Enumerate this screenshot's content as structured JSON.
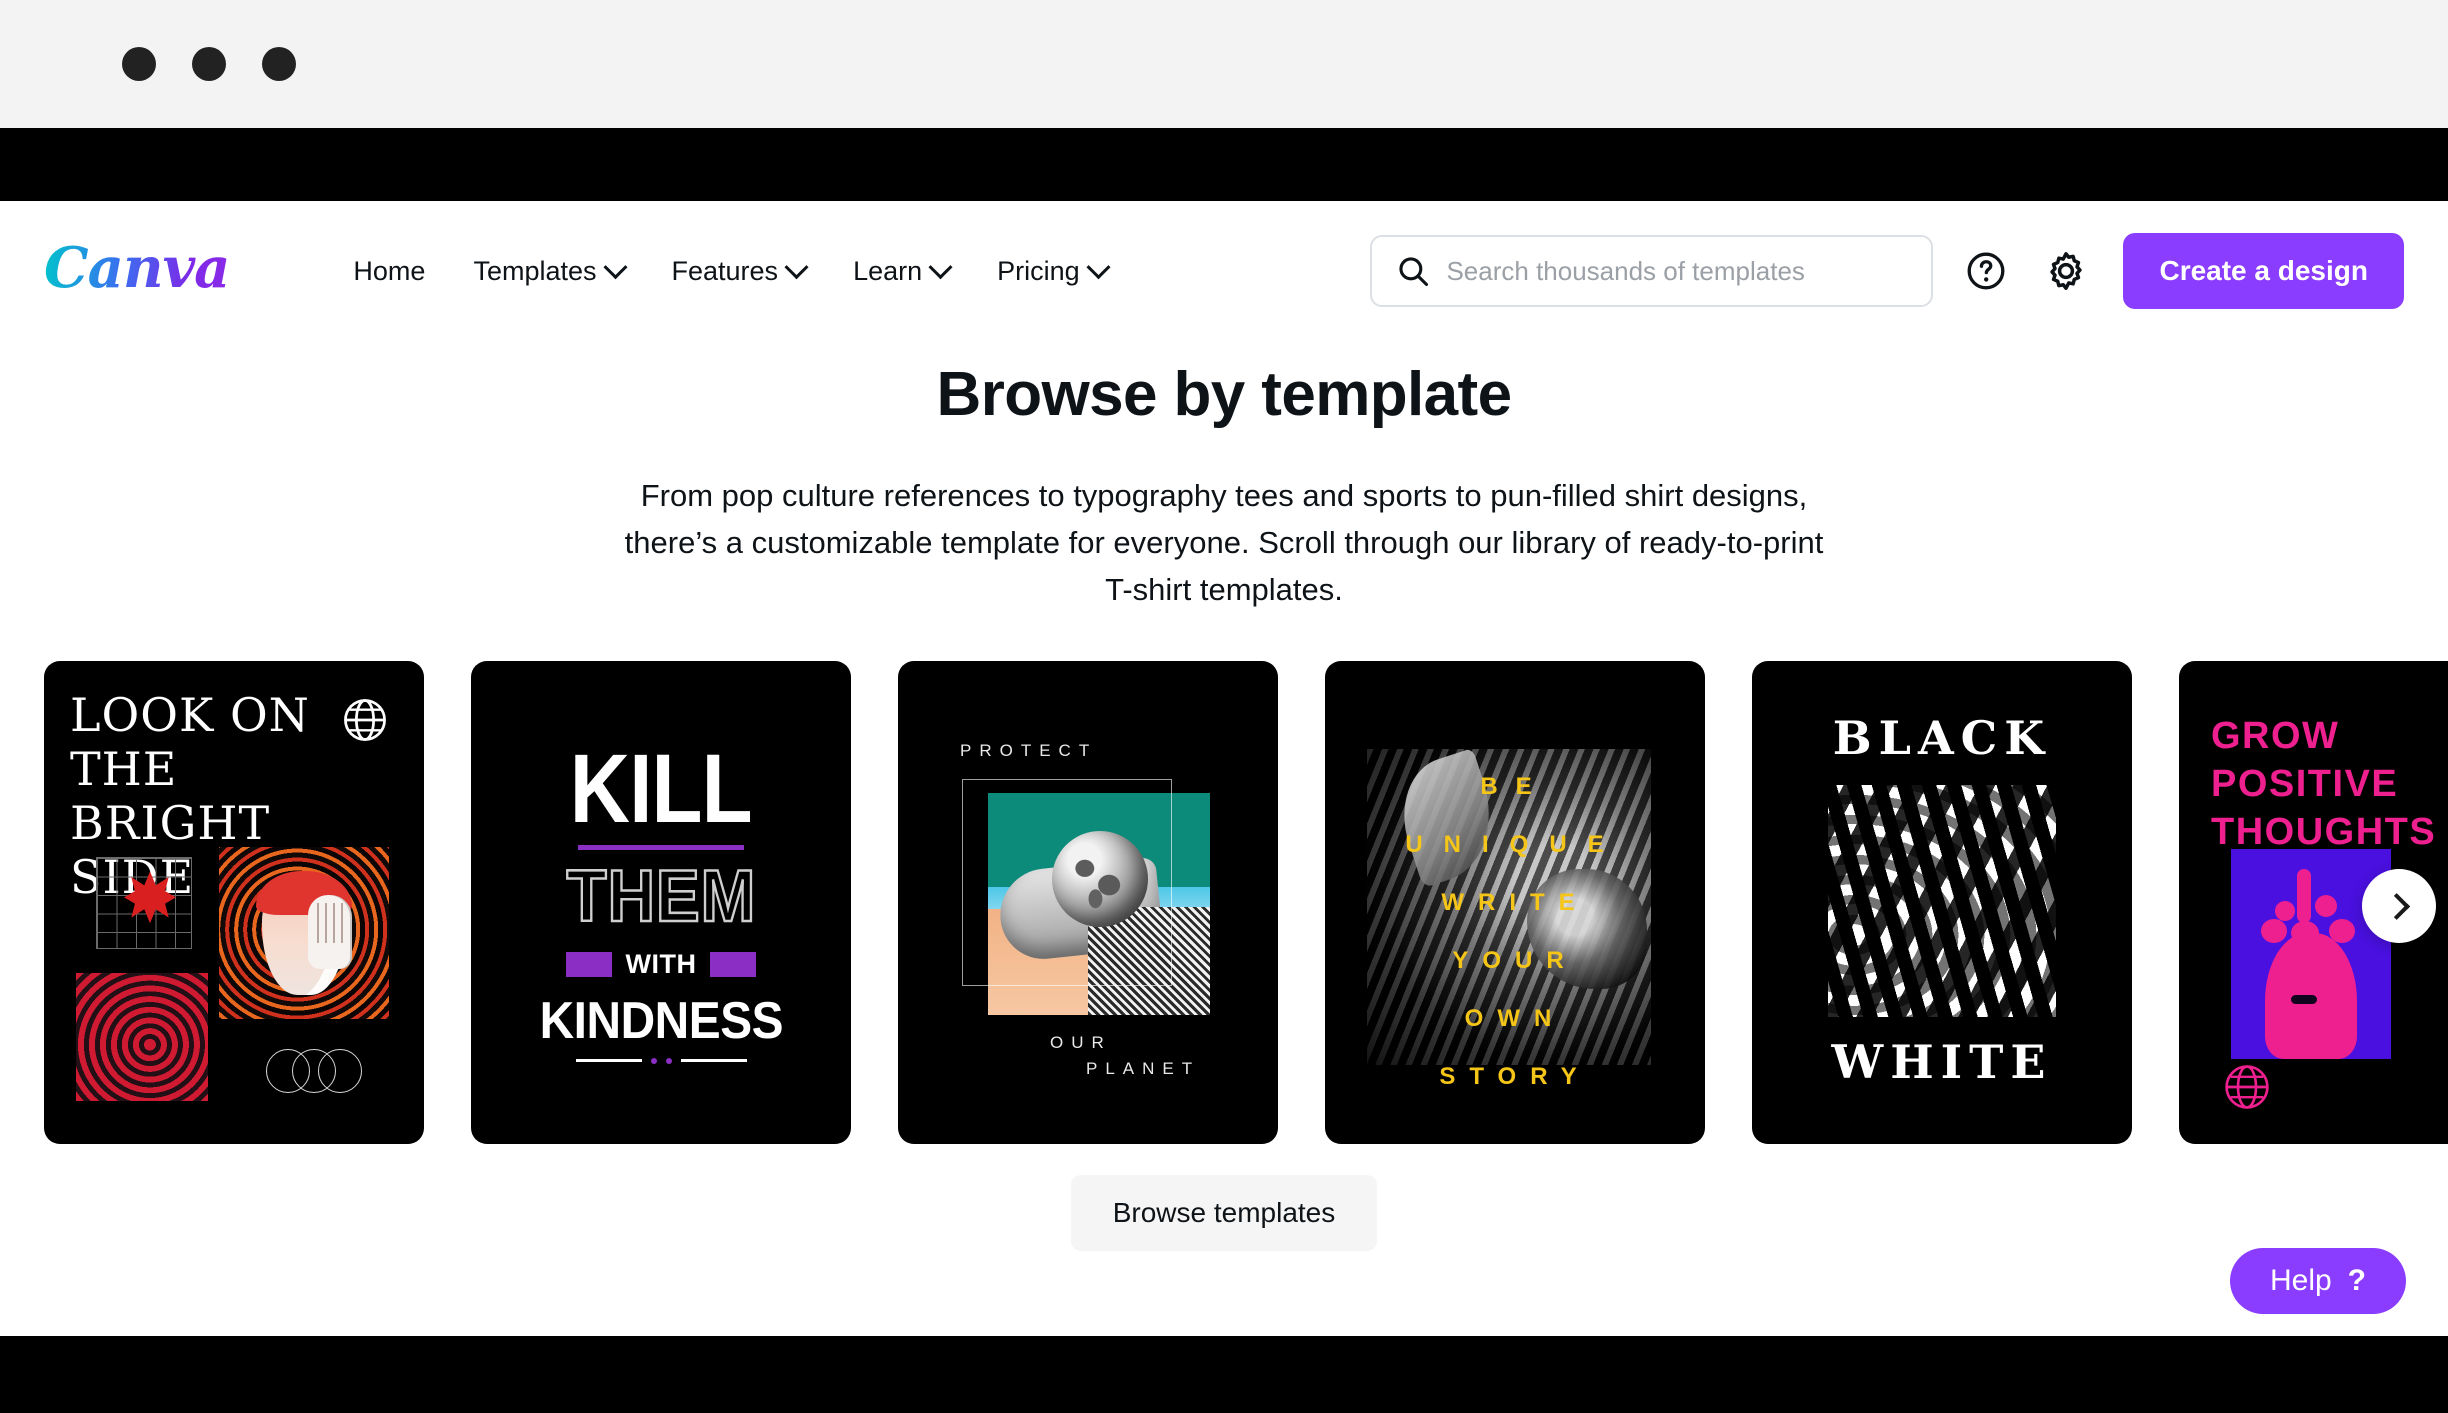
{
  "browser": {
    "dots": [
      "dot-1",
      "dot-2",
      "dot-3"
    ]
  },
  "header": {
    "logo_text": "Canva",
    "nav": [
      {
        "label": "Home",
        "has_chevron": false
      },
      {
        "label": "Templates",
        "has_chevron": true
      },
      {
        "label": "Features",
        "has_chevron": true
      },
      {
        "label": "Learn",
        "has_chevron": true
      },
      {
        "label": "Pricing",
        "has_chevron": true
      }
    ],
    "search": {
      "placeholder": "Search thousands of templates",
      "value": "",
      "icon": "search-icon"
    },
    "help_icon": "question-circle-icon",
    "settings_icon": "gear-icon",
    "create_button": "Create a design",
    "accent_color": "#8b3dff"
  },
  "hero": {
    "title": "Browse by template",
    "description": "From pop culture references to typography tees and sports to pun-filled shirt designs, there’s a customizable template for everyone. Scroll through our library of ready-to-print T-shirt templates."
  },
  "carousel": {
    "next_icon": "chevron-right-icon",
    "cards": [
      {
        "id": "look-on-the-bright-side",
        "lines": [
          "LOOK ON",
          "THE BRIGHT",
          "SIDE"
        ],
        "accent": "#d91f1f",
        "icons": [
          "globe-icon",
          "rings-icon"
        ]
      },
      {
        "id": "kill-them-with-kindness",
        "word1": "KILL",
        "word2": "THEM",
        "word3": "WITH",
        "word4": "KINDNESS",
        "accent": "#8b2ec4"
      },
      {
        "id": "protect-our-planet",
        "line1": "PROTECT",
        "line2": "OUR",
        "line3": "PLANET",
        "accent": "#0d8b7a"
      },
      {
        "id": "be-unique-write-your-own-story",
        "lines": [
          "BE",
          "UNIQUE",
          "WRITE",
          "YOUR",
          "OWN",
          "STORY"
        ],
        "accent": "#f5c518"
      },
      {
        "id": "black-white",
        "word_top": "BLACK",
        "word_bottom": "WHITE",
        "accent": "#ffffff"
      },
      {
        "id": "grow-positive-thoughts",
        "lines": [
          "GROW",
          "POSITIVE",
          "THOUGHTS"
        ],
        "accent": "#ee1f8e",
        "icons": [
          "globe-icon"
        ]
      }
    ]
  },
  "footer": {
    "browse_button": "Browse templates"
  },
  "help_widget": {
    "label": "Help",
    "symbol": "?",
    "color": "#8b3dff"
  }
}
